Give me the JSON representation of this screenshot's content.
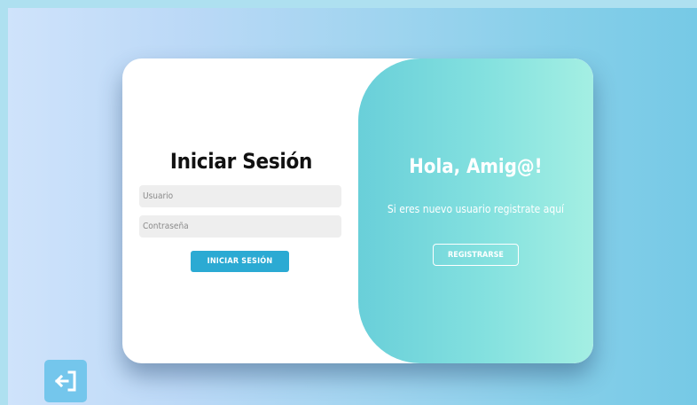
{
  "login": {
    "title": "Iniciar Sesión",
    "username_placeholder": "Usuario",
    "password_placeholder": "Contraseña",
    "submit_label": "INICIAR SESIÓN"
  },
  "welcome": {
    "title": "Hola, Amig@!",
    "subtitle": "Si eres nuevo usuario registrate aquí",
    "register_label": "REGISTRARSE"
  },
  "icons": {
    "exit": "logout-icon"
  },
  "colors": {
    "primary_button": "#2baad3",
    "panel_gradient_start": "#69cfd9",
    "panel_gradient_end": "#a4efe3",
    "exit_button": "#74c6ec"
  }
}
